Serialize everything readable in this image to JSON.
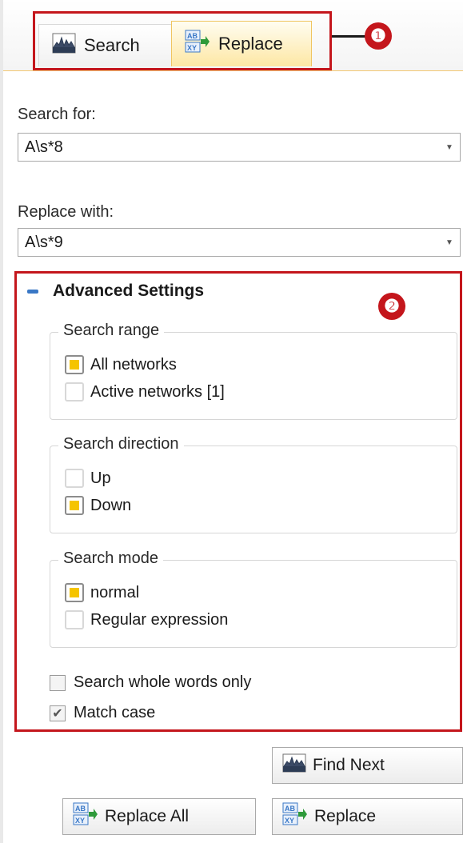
{
  "tabs": {
    "search_label": "Search",
    "replace_label": "Replace",
    "search_icon": "search-chart-icon",
    "replace_icon": "replace-ab-xy-icon",
    "active": "replace"
  },
  "callouts": {
    "one": "❶",
    "two": "❷",
    "color": "#c4161c"
  },
  "search_for": {
    "label": "Search for:",
    "value": "A\\s*8"
  },
  "replace_with": {
    "label": "Replace with:",
    "value": "A\\s*9"
  },
  "advanced": {
    "title": "Advanced Settings",
    "search_range": {
      "title": "Search range",
      "options": [
        "All networks",
        "Active networks [1]"
      ],
      "selected": "All networks"
    },
    "search_direction": {
      "title": "Search direction",
      "options": [
        "Up",
        "Down"
      ],
      "selected": "Down"
    },
    "search_mode": {
      "title": "Search mode",
      "options": [
        "normal",
        "Regular expression"
      ],
      "selected": "normal"
    },
    "whole_words": {
      "label": "Search whole words only",
      "checked": false
    },
    "match_case": {
      "label": "Match case",
      "checked": true
    }
  },
  "buttons": {
    "find_next": "Find Next",
    "replace_all": "Replace All",
    "replace": "Replace"
  },
  "colors": {
    "accent": "#f5c400",
    "tab_active_border": "#f0c561",
    "highlight_box": "#c4161c"
  }
}
